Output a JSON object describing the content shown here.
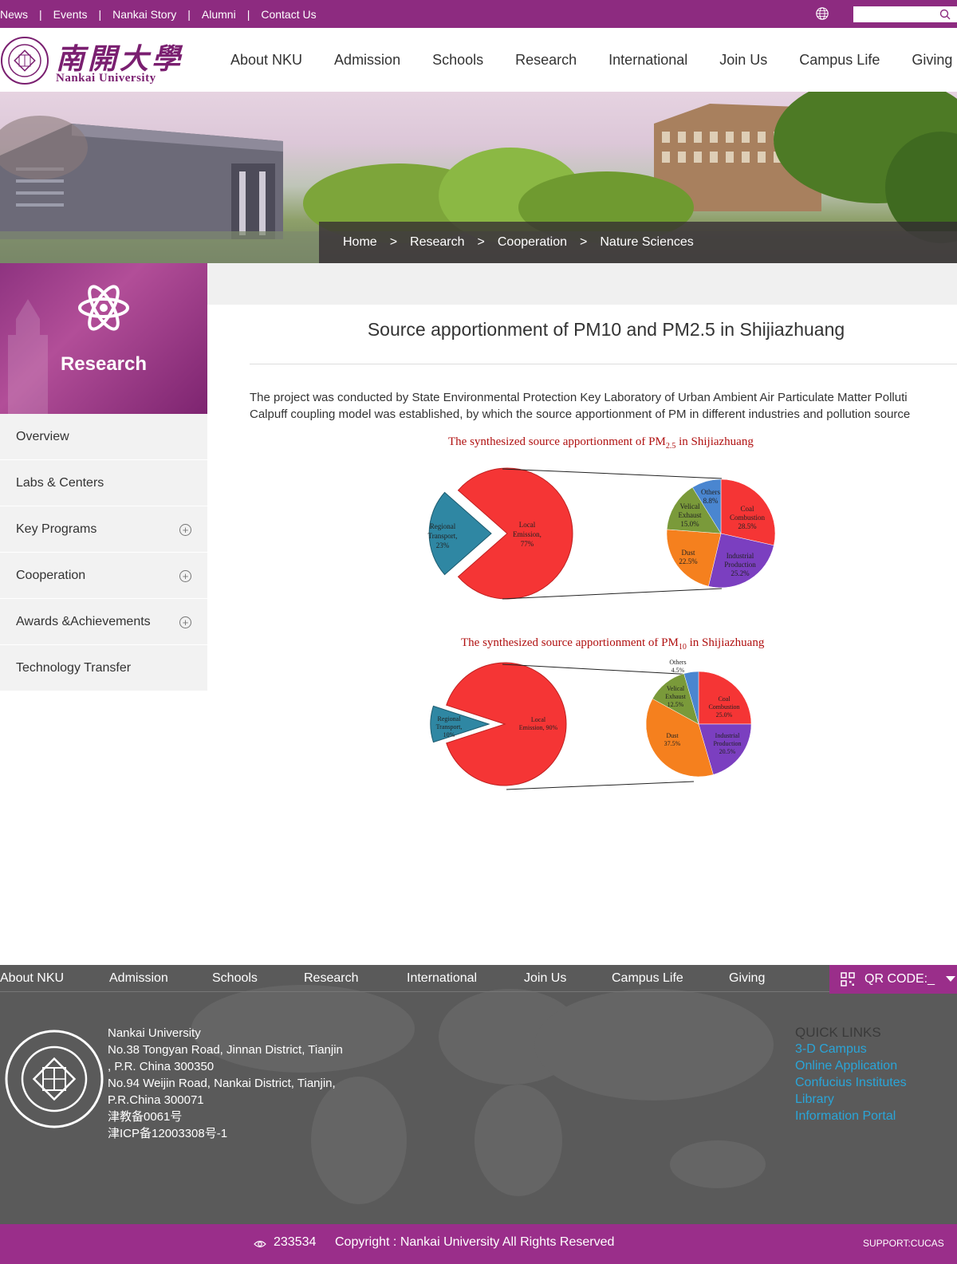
{
  "topbar": {
    "links": [
      "News",
      "Events",
      "Nankai Story",
      "Alumni",
      "Contact Us"
    ],
    "separator": "|",
    "search_placeholder": ""
  },
  "header": {
    "logo_cn": "南開大學",
    "logo_en": "Nankai University",
    "nav": [
      "About NKU",
      "Admission",
      "Schools",
      "Research",
      "International",
      "Join Us",
      "Campus Life",
      "Giving"
    ]
  },
  "breadcrumb": {
    "items": [
      "Home",
      "Research",
      "Cooperation",
      "Nature Sciences"
    ],
    "separator": ">"
  },
  "sidebar": {
    "title": "Research",
    "items": [
      {
        "label": "Overview",
        "expand": ""
      },
      {
        "label": "Labs & Centers",
        "expand": ""
      },
      {
        "label": "Key Programs",
        "expand": "+"
      },
      {
        "label": "Cooperation",
        "expand": "+"
      },
      {
        "label": "Awards &Achievements",
        "expand": "+"
      },
      {
        "label": "Technology Transfer",
        "expand": ""
      }
    ]
  },
  "article": {
    "title": "Source apportionment of PM10 and PM2.5 in Shijiazhuang",
    "line1": "The project was conducted by State Environmental Protection Key Laboratory of Urban Ambient Air Particulate Matter Polluti",
    "line2": " Calpuff coupling model was established, by which the source apportionment of PM in different industries and pollution source"
  },
  "chart_data": [
    {
      "type": "pie",
      "title": "The synthesized source apportionment of  PM2.5 in Shijiazhuang",
      "title_main": "The synthesized source apportionment of  PM",
      "title_sub": "2.5",
      "title_tail": " in Shijiazhuang",
      "overview": [
        {
          "label": "Regional Transport",
          "value": 23
        },
        {
          "label": "Local Emission",
          "value": 77
        }
      ],
      "detail": [
        {
          "label": "Coal Combustion",
          "value": 28.5,
          "color": "#f53535"
        },
        {
          "label": "Industrial Production",
          "value": 25.2,
          "color": "#7b3fc0"
        },
        {
          "label": "Dust",
          "value": 22.5,
          "color": "#f5801e"
        },
        {
          "label": "Velical Exhaust",
          "value": 15.0,
          "color": "#7a9a3a"
        },
        {
          "label": "Others",
          "value": 8.8,
          "color": "#4a86d0"
        }
      ],
      "overview_text": {
        "regional": [
          "Regional",
          "Transport,",
          "23%"
        ],
        "local": [
          "Local",
          "Emission,",
          "77%"
        ]
      },
      "detail_text": {
        "coal": [
          "Coal",
          "Combustion",
          "28.5%"
        ],
        "industrial": [
          "Industrial",
          "Production",
          "25.2%"
        ],
        "dust": [
          "Dust",
          "22.5%"
        ],
        "vehicle": [
          "Velical",
          "Exhaust",
          "15.0%"
        ],
        "others": [
          "Others",
          "8.8%"
        ]
      }
    },
    {
      "type": "pie",
      "title": "The synthesized source apportionment of  PM10 in Shijiazhuang",
      "title_main": "The synthesized source apportionment of  PM",
      "title_sub": "10",
      "title_tail": " in Shijiazhuang",
      "overview": [
        {
          "label": "Regional Transport",
          "value": 10
        },
        {
          "label": "Local Emission",
          "value": 90
        }
      ],
      "detail": [
        {
          "label": "Coal Combustion",
          "value": 25.0,
          "color": "#f53535"
        },
        {
          "label": "Industrial Production",
          "value": 20.5,
          "color": "#7b3fc0"
        },
        {
          "label": "Dust",
          "value": 37.5,
          "color": "#f5801e"
        },
        {
          "label": "Velical Exhaust",
          "value": 12.5,
          "color": "#7a9a3a"
        },
        {
          "label": "Others",
          "value": 4.5,
          "color": "#4a86d0"
        }
      ],
      "overview_text": {
        "regional": [
          "Regional",
          "Transport,",
          "10%"
        ],
        "local": [
          "Local",
          "Emission, 90%"
        ]
      },
      "detail_text": {
        "coal": [
          "Coal",
          "Combustion",
          "25.0%"
        ],
        "industrial": [
          "Industrial",
          "Production",
          "20.5%"
        ],
        "dust": [
          "Dust",
          "37.5%"
        ],
        "vehicle": [
          "Velical",
          "Exhaust",
          "12.5%"
        ],
        "others": [
          "Others",
          "4.5%"
        ]
      }
    }
  ],
  "footer": {
    "nav": [
      "About NKU",
      "Admission",
      "Schools",
      "Research",
      "International",
      "Join Us",
      "Campus Life",
      "Giving"
    ],
    "qr_label": "QR CODE:_",
    "address": [
      "Nankai University",
      "No.38 Tongyan Road, Jinnan District, Tianjin",
      ", P.R. China 300350",
      "No.94 Weijin Road,  Nankai District, Tianjin,",
      "P.R.China  300071",
      "津教备0061号",
      "津ICP备12003308号-1"
    ],
    "quick_links_title": "QUICK LINKS",
    "quick_links": [
      "3-D Campus",
      "Online Application",
      "Confucius Institutes",
      "Library",
      "Information Portal"
    ],
    "views": "233534",
    "copyright": "Copyright : Nankai University All Rights Reserved",
    "support": "SUPPORT:CUCAS"
  },
  "colors": {
    "brand_purple": "#8d2b80",
    "footer_gray": "#5a5a5a",
    "link_blue": "#2aa5d8"
  }
}
